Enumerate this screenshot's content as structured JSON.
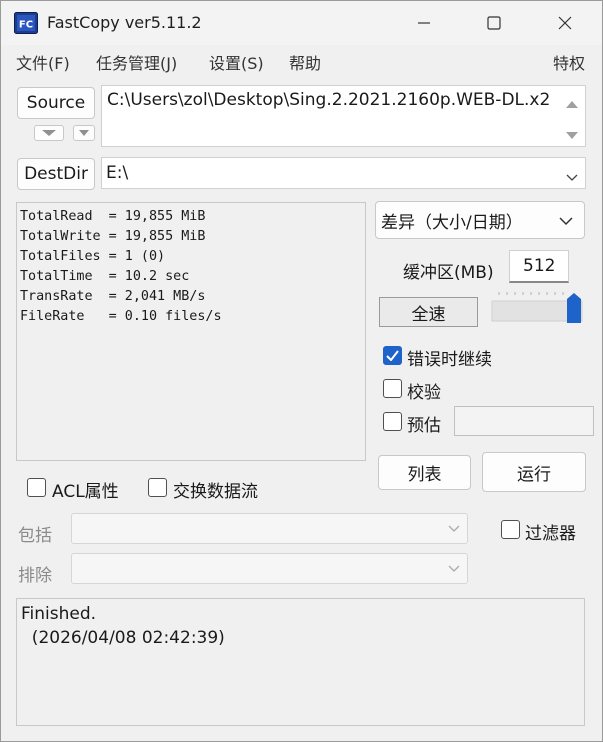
{
  "window": {
    "title": "FastCopy ver5.11.2",
    "icon_text": "FC"
  },
  "menu": {
    "items": [
      "文件(F)",
      "任务管理(J)",
      "设置(S)",
      "帮助"
    ],
    "right_item": "特权"
  },
  "source": {
    "button_label": "Source",
    "path": "C:\\Users\\zol\\Desktop\\Sing.2.2021.2160p.WEB-DL.x2"
  },
  "dest": {
    "button_label": "DestDir",
    "path": "E:\\"
  },
  "stats": {
    "lines": [
      "TotalRead  = 19,855 MiB",
      "TotalWrite = 19,855 MiB",
      "TotalFiles = 1 (0)",
      "TotalTime  = 10.2 sec",
      "TransRate  = 2,041 MB/s",
      "FileRate   = 0.10 files/s"
    ]
  },
  "mode": {
    "selected": "差异（大小/日期）"
  },
  "buffer": {
    "label": "缓冲区(MB)",
    "value": "512"
  },
  "speed": {
    "label": "全速",
    "slider_level": 1.0
  },
  "options": {
    "continue_on_error": {
      "label": "错误时继续",
      "checked": true
    },
    "verify": {
      "label": "校验",
      "checked": false
    },
    "estimate": {
      "label": "预估",
      "checked": false
    }
  },
  "actions": {
    "list_label": "列表",
    "run_label": "运行"
  },
  "checks": {
    "acl": {
      "label": "ACL属性",
      "checked": false
    },
    "streams": {
      "label": "交换数据流",
      "checked": false
    }
  },
  "filters": {
    "include_label": "包括",
    "exclude_label": "排除",
    "filter_label": "过滤器",
    "filter_checked": false
  },
  "log": {
    "lines": [
      "Finished.",
      "  (2026/04/08 02:42:39)"
    ]
  },
  "colors": {
    "accent": "#1e63c9",
    "background": "#f0f0f0"
  }
}
